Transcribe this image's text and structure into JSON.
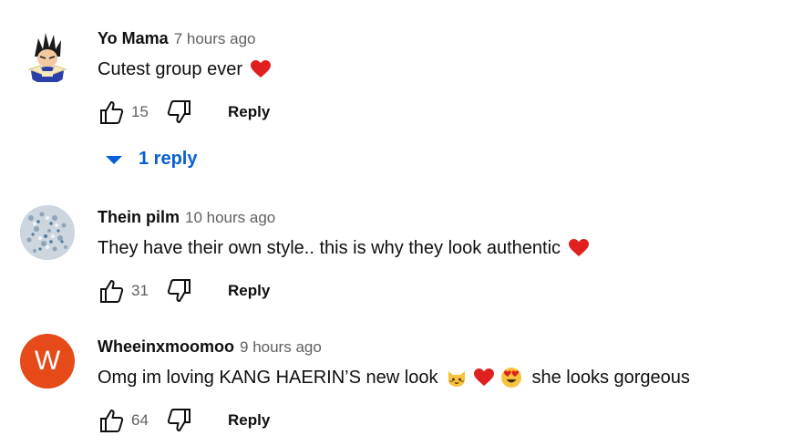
{
  "comments": [
    {
      "author": "Yo Mama",
      "time": "7 hours ago",
      "text": "Cutest group ever",
      "emojis": [
        "heart-emoji"
      ],
      "likes": "15",
      "reply_label": "Reply",
      "replies_label": "1 reply",
      "avatar": "vegeta-avatar"
    },
    {
      "author": "Thein pilm",
      "time": "10 hours ago",
      "text": "They have their own style.. this is why they look authentic",
      "emojis": [
        "heart-emoji"
      ],
      "likes": "31",
      "reply_label": "Reply",
      "avatar": "photo-avatar"
    },
    {
      "author": "Wheeinxmoomoo",
      "time": "9 hours ago",
      "text_before": "Omg im loving KANG HAERIN’S new look",
      "text_after": "she looks gorgeous",
      "emojis": [
        "cat-emoji",
        "heart-emoji",
        "heart-eyes-emoji"
      ],
      "likes": "64",
      "reply_label": "Reply",
      "avatar_letter": "W",
      "avatar_color": "#e64a19"
    }
  ],
  "colors": {
    "link_blue": "#065fd4",
    "secondary_text": "#606060",
    "heart_red": "#e0201e"
  }
}
